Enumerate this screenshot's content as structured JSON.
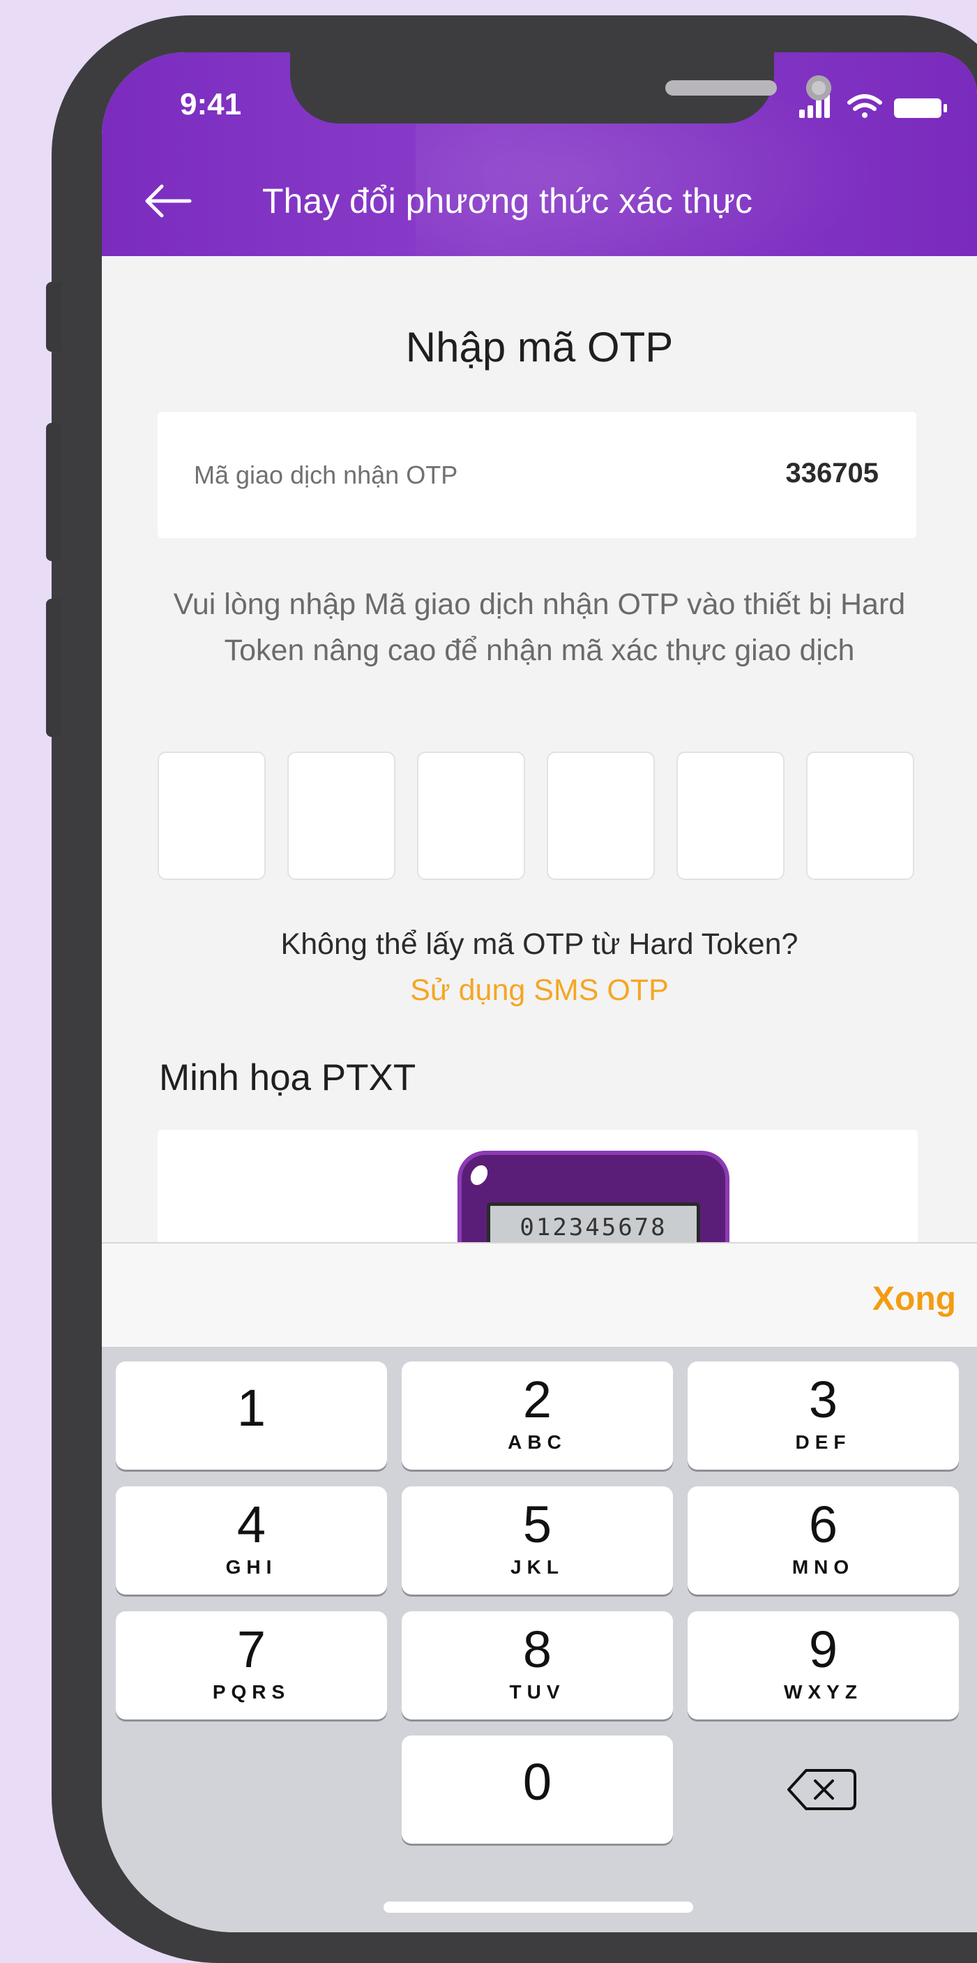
{
  "status_bar": {
    "time": "9:41"
  },
  "header": {
    "title": "Thay đổi phương thức xác thực"
  },
  "otp": {
    "heading": "Nhập mã OTP",
    "code_label": "Mã giao dịch nhận OTP",
    "code_value": "336705",
    "instructions": "Vui lòng nhập Mã giao dịch nhận OTP vào thiết bị Hard Token nâng cao để nhận mã xác thực giao dịch",
    "digits": [
      "",
      "",
      "",
      "",
      "",
      ""
    ],
    "cant_get": "Không thể lấy mã OTP từ Hard Token?",
    "sms_link": "Sử dụng SMS OTP"
  },
  "illustration": {
    "title": "Minh họa PTXT",
    "token_display": "012345678"
  },
  "keyboard": {
    "done_label": "Xong",
    "keys": [
      {
        "digit": "1",
        "letters": ""
      },
      {
        "digit": "2",
        "letters": "ABC"
      },
      {
        "digit": "3",
        "letters": "DEF"
      },
      {
        "digit": "4",
        "letters": "GHI"
      },
      {
        "digit": "5",
        "letters": "JKL"
      },
      {
        "digit": "6",
        "letters": "MNO"
      },
      {
        "digit": "7",
        "letters": "PQRS"
      },
      {
        "digit": "8",
        "letters": "TUV"
      },
      {
        "digit": "9",
        "letters": "WXYZ"
      },
      {
        "digit": "0",
        "letters": ""
      }
    ]
  },
  "colors": {
    "header_purple": "#7b2cbf",
    "link_orange": "#f5a623",
    "done_orange": "#f39c12"
  }
}
